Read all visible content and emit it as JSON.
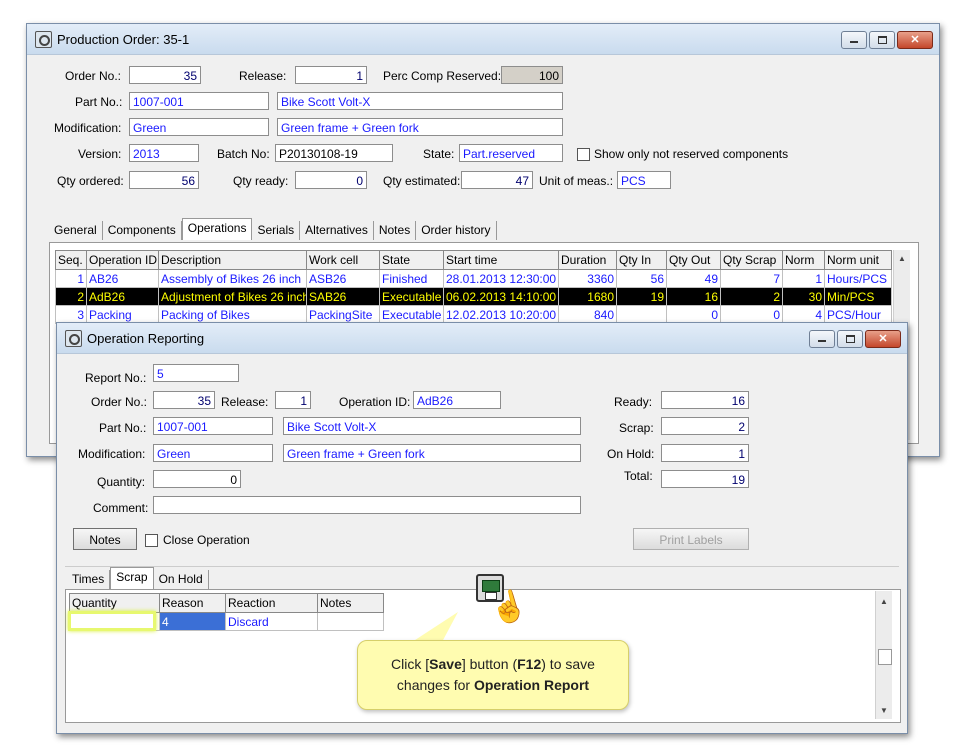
{
  "po": {
    "title": "Production Order: 35-1",
    "order_no_label": "Order No.:",
    "order_no": "35",
    "release_label": "Release:",
    "release": "1",
    "perc_label": "Perc Comp Reserved:",
    "perc": "100",
    "part_no_label": "Part No.:",
    "part_no": "1007-001",
    "part_desc": "Bike Scott Volt-X",
    "modification_label": "Modification:",
    "modification": "Green",
    "modification_desc": "Green frame + Green fork",
    "version_label": "Version:",
    "version": "2013",
    "batch_label": "Batch No:",
    "batch": "P20130108-19",
    "state_label": "State:",
    "state": "Part.reserved",
    "show_only_label": "Show only not reserved components",
    "qty_ordered_label": "Qty ordered:",
    "qty_ordered": "56",
    "qty_ready_label": "Qty ready:",
    "qty_ready": "0",
    "qty_est_label": "Qty estimated:",
    "qty_est": "47",
    "unit_label": "Unit of meas.:",
    "unit": "PCS",
    "tabs": [
      "General",
      "Components",
      "Operations",
      "Serials",
      "Alternatives",
      "Notes",
      "Order history"
    ],
    "columns": [
      "Seq.",
      "Operation ID",
      "Description",
      "Work cell",
      "State",
      "Start time",
      "Duration",
      "Qty In",
      "Qty Out",
      "Qty Scrap",
      "Norm",
      "Norm unit"
    ],
    "rows": [
      [
        "1",
        "AB26",
        "Assembly of Bikes 26 inch",
        "ASB26",
        "Finished",
        "28.01.2013 12:30:00",
        "3360",
        "56",
        "49",
        "7",
        "1",
        "Hours/PCS"
      ],
      [
        "2",
        "AdB26",
        "Adjustment of Bikes 26 inch",
        "SAB26",
        "Executable",
        "06.02.2013 14:10:00",
        "1680",
        "19",
        "16",
        "2",
        "30",
        "Min/PCS"
      ],
      [
        "3",
        "Packing",
        "Packing of Bikes",
        "PackingSite",
        "Executable",
        "12.02.2013 10:20:00",
        "840",
        "",
        "0",
        "0",
        "4",
        "PCS/Hour"
      ]
    ]
  },
  "op": {
    "title": "Operation Reporting",
    "report_no_label": "Report No.:",
    "report_no": "5",
    "order_no_label": "Order No.:",
    "order_no": "35",
    "release_label": "Release:",
    "release": "1",
    "operation_id_label": "Operation ID:",
    "operation_id": "AdB26",
    "part_no_label": "Part No.:",
    "part_no": "1007-001",
    "part_desc": "Bike Scott Volt-X",
    "modification_label": "Modification:",
    "modification": "Green",
    "modification_desc": "Green frame + Green fork",
    "quantity_label": "Quantity:",
    "quantity": "0",
    "comment_label": "Comment:",
    "comment": "",
    "ready_label": "Ready:",
    "ready": "16",
    "scrap_label": "Scrap:",
    "scrap": "2",
    "onhold_label": "On Hold:",
    "onhold": "1",
    "total_label": "Total:",
    "total": "19",
    "notes_btn": "Notes",
    "close_op_label": "Close Operation",
    "print_labels_btn": "Print Labels",
    "tabs": [
      "Times",
      "Scrap",
      "On Hold"
    ],
    "scrap_columns": [
      "Quantity",
      "Reason",
      "Reaction",
      "Notes"
    ],
    "scrap_row": [
      "",
      "4",
      "Discard",
      ""
    ]
  },
  "callout": {
    "line1_pre": "Click [",
    "line1_bold": "Save",
    "line1_mid": "] button (",
    "line1_bold2": "F12",
    "line1_post": ") to save",
    "line2_pre": "changes for ",
    "line2_bold": "Operation Report"
  }
}
